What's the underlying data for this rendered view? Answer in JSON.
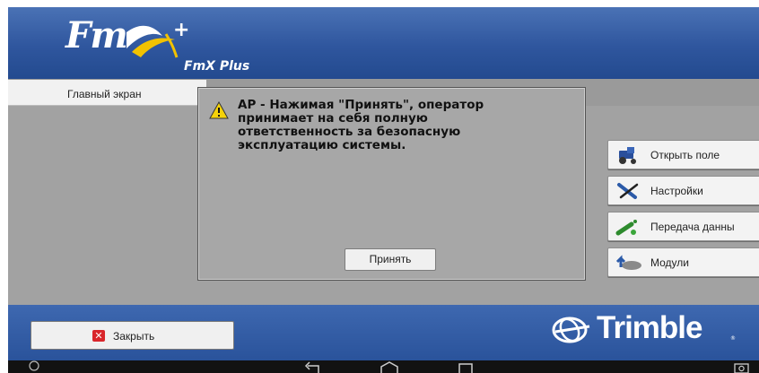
{
  "header": {
    "logo_main": "Fm",
    "logo_plus": "+",
    "logo_sub": "FmX Plus"
  },
  "tabs": [
    {
      "label": "Главный экран"
    }
  ],
  "side_buttons": [
    {
      "label": "Открыть поле",
      "icon": "tractor-icon"
    },
    {
      "label": "Настройки",
      "icon": "settings-tools-icon"
    },
    {
      "label": "Передача данны",
      "icon": "data-transfer-icon"
    },
    {
      "label": "Модули",
      "icon": "modules-icon"
    }
  ],
  "dialog": {
    "icon": "warning-icon",
    "message": "AP - Нажимая \"Принять\", оператор\nпринимает на себя полную\nответственность за безопасную\nэксплуатацию системы.",
    "accept_label": "Принять"
  },
  "footer": {
    "close_label": "Закрыть",
    "close_icon_glyph": "✕",
    "brand": "Trimble",
    "brand_mark": "®"
  },
  "colors": {
    "header_blue": "#2f569e",
    "warning_yellow": "#f5d20a",
    "close_red": "#d9262b",
    "logo_accent": "#f2c200"
  }
}
